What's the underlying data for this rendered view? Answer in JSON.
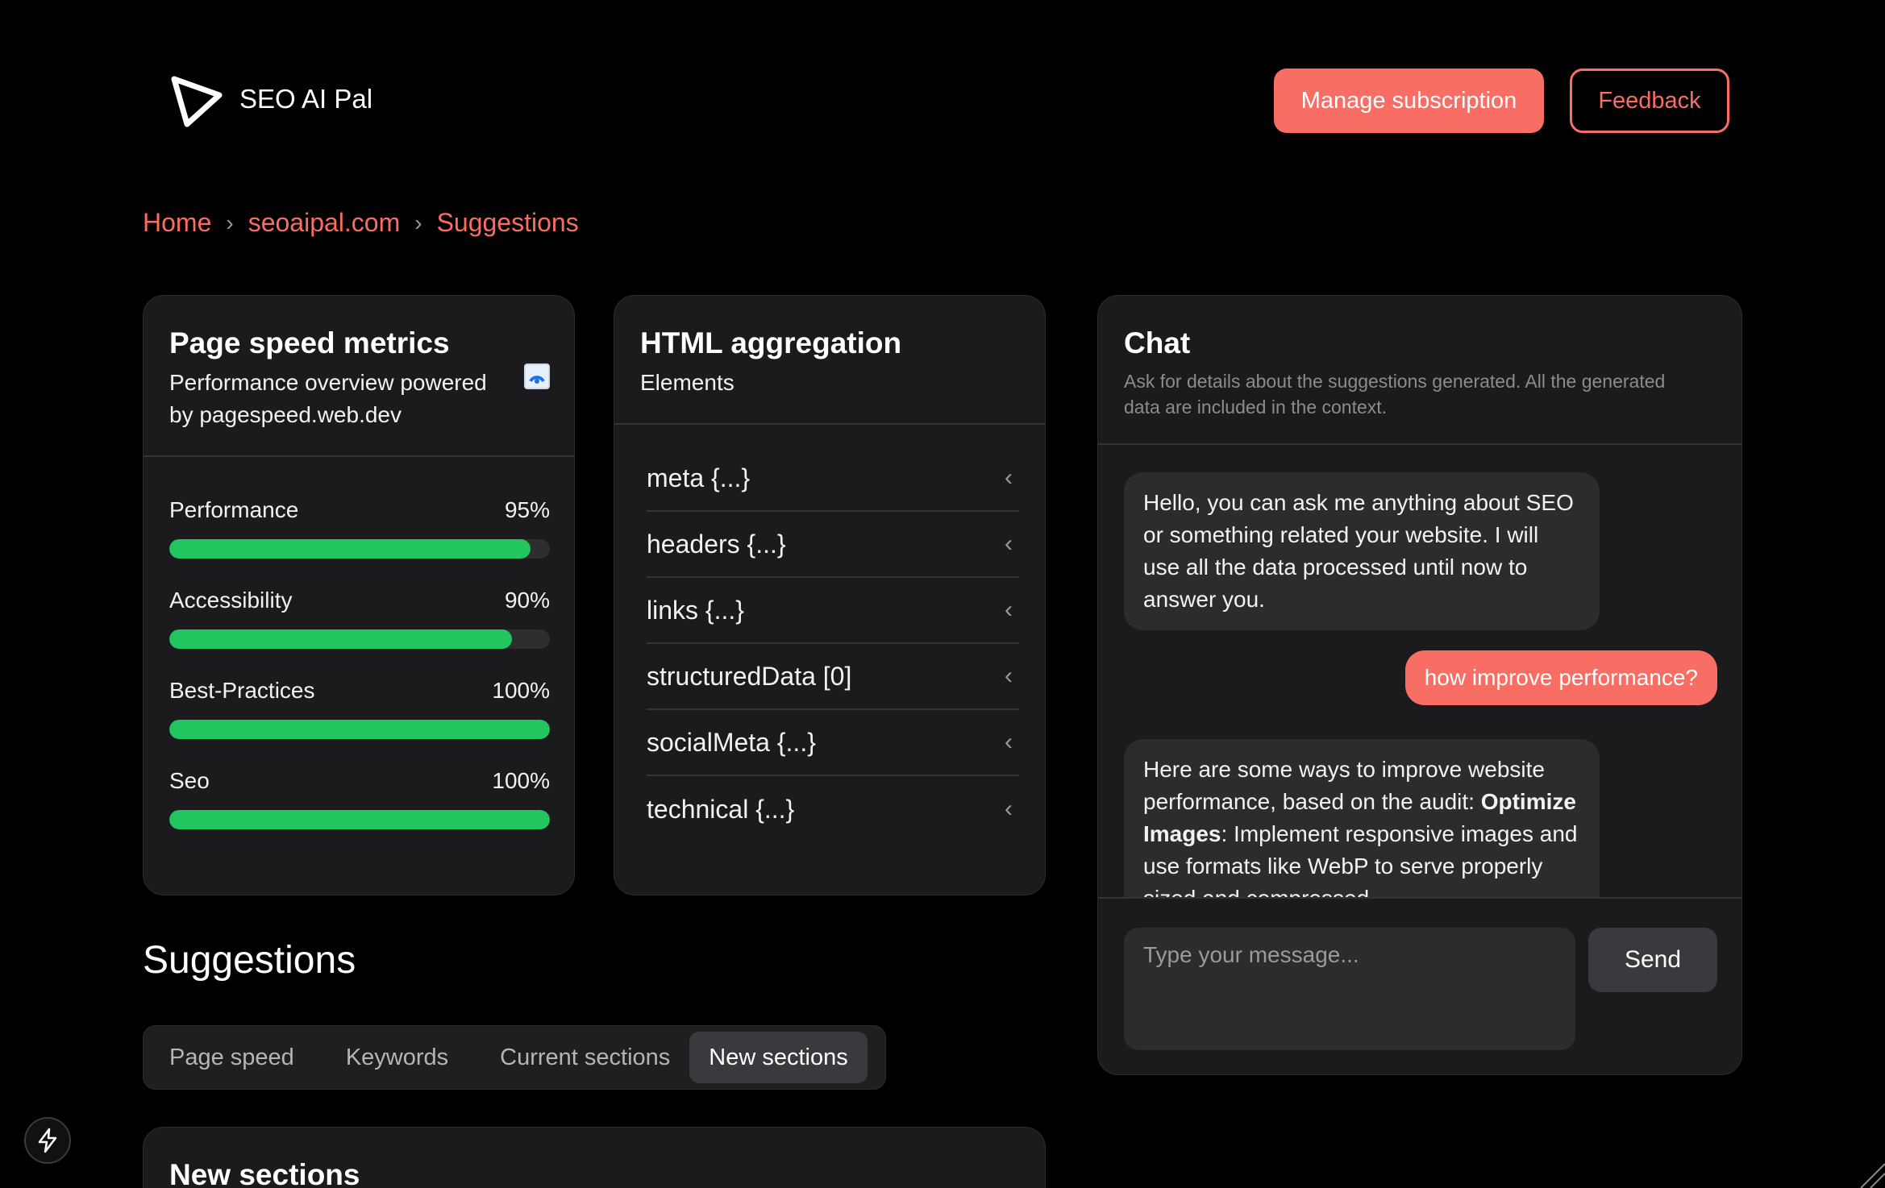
{
  "header": {
    "brand": "SEO AI Pal",
    "manage_label": "Manage subscription",
    "feedback_label": "Feedback"
  },
  "breadcrumb": [
    "Home",
    "seoaipal.com",
    "Suggestions"
  ],
  "page_speed": {
    "title": "Page speed metrics",
    "subtitle": "Performance overview powered by pagespeed.web.dev",
    "metrics": [
      {
        "label": "Performance",
        "value": "95%",
        "fraction": 0.95
      },
      {
        "label": "Accessibility",
        "value": "90%",
        "fraction": 0.9
      },
      {
        "label": "Best-Practices",
        "value": "100%",
        "fraction": 1.0
      },
      {
        "label": "Seo",
        "value": "100%",
        "fraction": 1.0
      }
    ]
  },
  "html_aggregation": {
    "title": "HTML aggregation",
    "subtitle": "Elements",
    "items": [
      "meta {...}",
      "headers {...}",
      "links {...}",
      "structuredData [0]",
      "socialMeta {...}",
      "technical {...}"
    ]
  },
  "chat": {
    "title": "Chat",
    "description": "Ask for details about the suggestions generated. All the generated data are included in the context.",
    "messages": [
      {
        "role": "bot",
        "text": "Hello, you can ask me anything about SEO or something related your website. I will use all the data processed until now to answer you."
      },
      {
        "role": "user",
        "text": "how improve performance?"
      },
      {
        "role": "bot",
        "intro": "Here are some ways to improve website performance, based on the audit:",
        "bold": "Optimize Images",
        "rest": ": Implement responsive images and use formats like WebP to serve properly sized and compressed"
      }
    ],
    "input_placeholder": "Type your message...",
    "send_label": "Send"
  },
  "suggestions": {
    "title": "Suggestions",
    "tabs": [
      "Page speed",
      "Keywords",
      "Current sections",
      "New sections"
    ],
    "active_tab": "New sections",
    "section_title": "New sections"
  },
  "colors": {
    "accent": "#f86e65",
    "progress": "#22c55e",
    "card": "#1b1b1d"
  }
}
